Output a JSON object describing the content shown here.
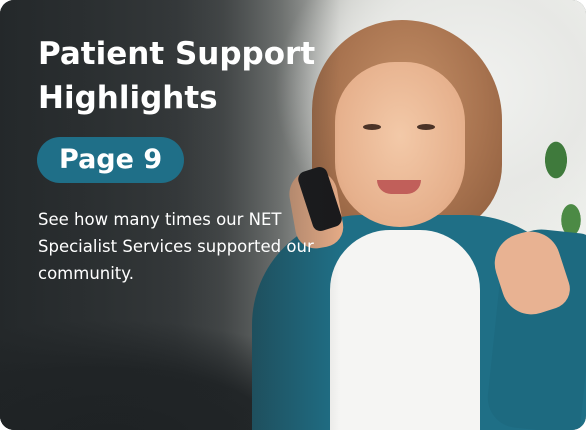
{
  "card": {
    "title": "Patient Support Highlights",
    "badge": "Page 9",
    "description": "See how many times our NET Specialist Services supported our community."
  },
  "colors": {
    "accent": "#1f6f88",
    "text": "#ffffff"
  }
}
